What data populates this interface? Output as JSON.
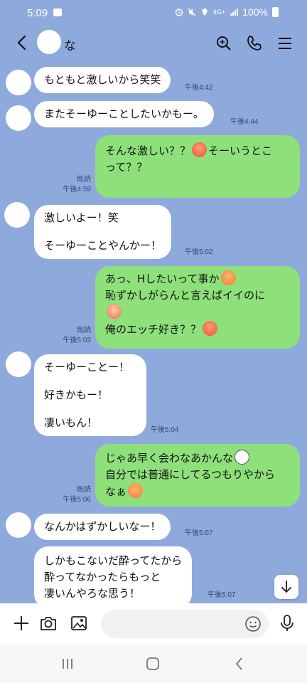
{
  "status_bar": {
    "time": "5:09",
    "network": "4G+",
    "battery": "100%"
  },
  "header": {
    "contact_name": "な"
  },
  "messages": [
    {
      "dir": "in",
      "lines": [
        "もともと激しいから笑笑"
      ],
      "time": "午後4:42"
    },
    {
      "dir": "in",
      "lines": [
        "またそーゆーことしたいかもー。"
      ],
      "time": "午後4:44"
    },
    {
      "dir": "out",
      "read": "既読",
      "time": "午後4:59",
      "lines": [
        "そんな激しい？？",
        "そーいうとこ",
        "って？？"
      ]
    },
    {
      "dir": "in",
      "lines": [
        "激しいよー！笑",
        "",
        "そーゆーことやんかー！"
      ],
      "time": "午後5:02"
    },
    {
      "dir": "out",
      "read": "既読",
      "time": "午後5:03",
      "lines": [
        "あっ、Hしたいって事か",
        "恥ずかしがらんと言えばイイのに",
        "俺のエッチ好き？？"
      ]
    },
    {
      "dir": "in",
      "lines": [
        "そーゆーことー！",
        "",
        "好きかもー！",
        "",
        "凄いもん！"
      ],
      "time": "午後5:04"
    },
    {
      "dir": "out",
      "read": "既読",
      "time": "午後5:06",
      "lines": [
        "じゃあ早く会わなあかんな",
        "自分では普通にしてるつもりやから",
        "なぁ"
      ]
    },
    {
      "dir": "in",
      "lines": [
        "なんかはずかしいなー！"
      ],
      "time": "午後5:07"
    },
    {
      "dir": "in",
      "lines": [
        "しかもこないだ酔ってたから",
        "酔ってなかったらもっと",
        "凄いんやろな思う！"
      ],
      "time": "午後5:07"
    }
  ],
  "input": {
    "placeholder": ""
  },
  "colors": {
    "background": "#8eaadc",
    "incoming_bubble": "#ffffff",
    "outgoing_bubble": "#8de07a"
  },
  "icons": [
    "back-icon",
    "search-icon",
    "phone-icon",
    "menu-icon",
    "plus-icon",
    "camera-icon",
    "image-icon",
    "sticker-icon",
    "mic-icon",
    "scroll-down-icon"
  ]
}
